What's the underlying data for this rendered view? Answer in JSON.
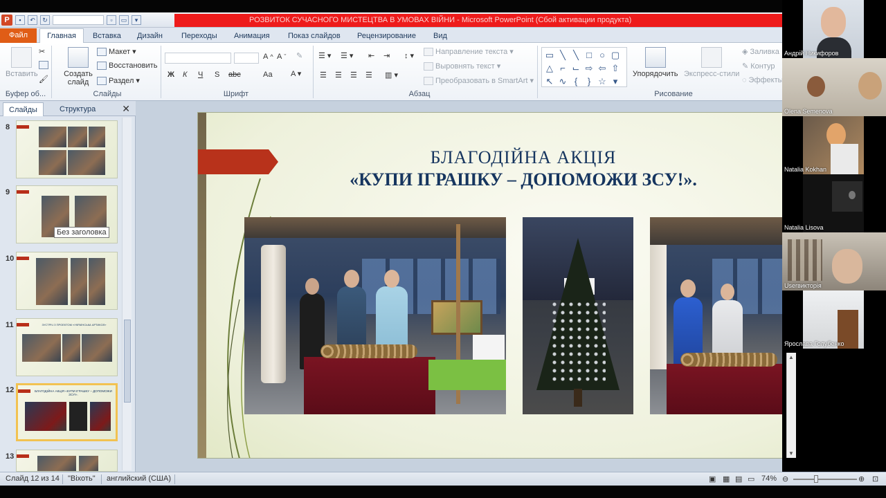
{
  "window": {
    "title": "РОЗВИТОК СУЧАСНОГО МИСТЕЦТВА В УМОВАХ ВІЙНИ - Microsoft PowerPoint (Сбой активации продукта)"
  },
  "tabs": [
    "Файл",
    "Главная",
    "Вставка",
    "Дизайн",
    "Переходы",
    "Анимация",
    "Показ слайдов",
    "Рецензирование",
    "Вид"
  ],
  "ribbon": {
    "paste": "Вставить",
    "clipboard_group": "Буфер об...",
    "new_slide": "Создать слайд",
    "layout": "Макет",
    "reset": "Восстановить",
    "section": "Раздел",
    "slides_group": "Слайды",
    "font_group": "Шрифт",
    "paragraph_group": "Абзац",
    "text_direction": "Направление текста",
    "align_text": "Выровнять текст",
    "smartart": "Преобразовать в SmartArt",
    "arrange": "Упорядочить",
    "quick_styles": "Экспресс-стили",
    "fill": "Заливка",
    "outline": "Контур",
    "effects": "Эффекты",
    "drawing_group": "Рисование",
    "font_buttons": [
      "Ж",
      "К",
      "Ч",
      "S",
      "abc",
      "Аа"
    ]
  },
  "left_pane": {
    "tab_slides": "Слайды",
    "tab_outline": "Структура",
    "close": "✕",
    "thumbnails": [
      {
        "num": "8"
      },
      {
        "num": "9"
      },
      {
        "num": "10"
      },
      {
        "num": "11",
        "caption": "ЗУСТРІЧ З ПРОЕКТОМ «УКРАЇНСЬКА АРТИКОЛ»"
      },
      {
        "num": "12",
        "caption": "БЛАГОДІЙНА АКЦІЯ «КУПИ ІГРАШКУ – ДОПОМОЖИ ЗСУ!»."
      },
      {
        "num": "13"
      }
    ],
    "tooltip": "Без заголовка"
  },
  "slide": {
    "title_line1": "БЛАГОДІЙНА АКЦІЯ",
    "title_line2": "«КУПИ ІГРАШКУ – ДОПОМОЖИ ЗСУ!»."
  },
  "participants": [
    {
      "name": "Андрій Никифоров"
    },
    {
      "name": "Olena Semenova"
    },
    {
      "name": "Natalia Kokhan"
    },
    {
      "name": "Natalia Lisova"
    },
    {
      "name": "Userвикторія"
    },
    {
      "name": "Ярослава Голубенко"
    }
  ],
  "status": {
    "slide": "Слайд 12 из 14",
    "theme": "\"Віхоть\"",
    "language": "английский (США)",
    "zoom": "74%"
  },
  "colors": {
    "title_bar_red": "#ee1b1b",
    "file_tab": "#e05d16",
    "slide_arrow": "#b8321b",
    "title_text": "#16355f"
  }
}
